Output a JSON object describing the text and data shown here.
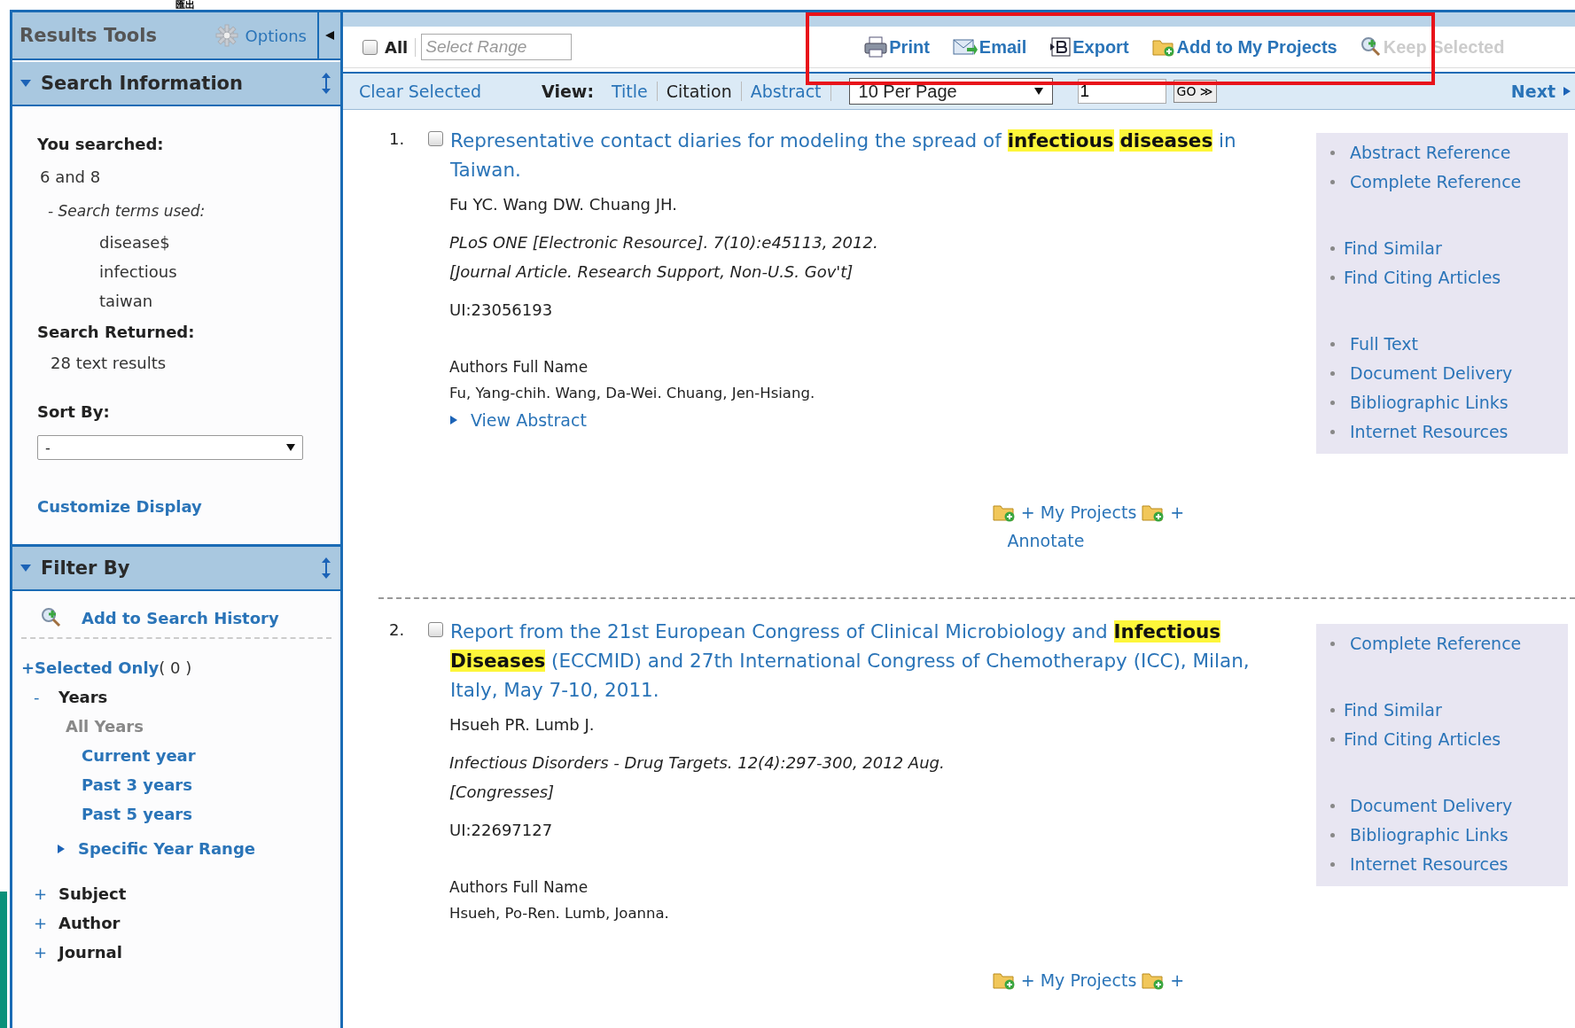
{
  "annotation_text": "匯出",
  "results_tools": {
    "title": "Results Tools",
    "options": "Options"
  },
  "search_information": {
    "title": "Search Information",
    "expanded": true,
    "you_searched_label": "You searched:",
    "query": "6 and 8",
    "terms_label": "- Search terms used:",
    "terms": [
      "disease$",
      "infectious",
      "taiwan"
    ],
    "returned_label": "Search Returned:",
    "returned": "28 text results",
    "sort_label": "Sort By:",
    "sort_value": "-",
    "customize": "Customize Display"
  },
  "filter_by": {
    "title": "Filter By",
    "expanded": true,
    "add_history": "Add to Search History",
    "selected_only": "+Selected Only",
    "selected_count": "( 0 )",
    "groups": [
      {
        "toggle": "-",
        "label": "Years",
        "expanded": true,
        "children": [
          {
            "label": "All Years",
            "selected": true
          },
          {
            "label": "Current year",
            "selected": false
          },
          {
            "label": "Past 3 years",
            "selected": false
          },
          {
            "label": "Past 5 years",
            "selected": false
          }
        ],
        "range": "Specific Year Range"
      },
      {
        "toggle": "+",
        "label": "Subject",
        "expanded": false
      },
      {
        "toggle": "+",
        "label": "Author",
        "expanded": false
      },
      {
        "toggle": "+",
        "label": "Journal",
        "expanded": false
      }
    ]
  },
  "toolbar": {
    "all_label": "All",
    "all_checked": false,
    "range_placeholder": "Select Range",
    "actions": [
      {
        "kind": "print",
        "label": "Print",
        "disabled": false
      },
      {
        "kind": "email",
        "label": "Email",
        "disabled": false
      },
      {
        "kind": "export",
        "label": "Export",
        "disabled": false
      },
      {
        "kind": "projects",
        "label": "Add to My Projects",
        "disabled": false
      },
      {
        "kind": "keep",
        "label": "Keep Selected",
        "disabled": true
      }
    ],
    "clear": "Clear Selected",
    "view_label": "View:",
    "views": [
      {
        "label": "Title",
        "selected": false
      },
      {
        "label": "Citation",
        "selected": true
      },
      {
        "label": "Abstract",
        "selected": false
      }
    ],
    "per_page": "10 Per Page",
    "page": "1",
    "go": "GO ≫",
    "next": "Next"
  },
  "results": [
    {
      "number": "1.",
      "checked": false,
      "title": "Representative contact diaries for modeling the spread of **infectious** **diseases** in Taiwan.",
      "authors": "Fu YC. Wang DW. Chuang JH.",
      "source": "PLoS ONE [Electronic Resource]. 7(10):e45113, 2012.",
      "pub_type": "[Journal Article. Research Support, Non-U.S. Gov't]",
      "ui_label": "UI:",
      "ui": "23056193",
      "full_name_label": "Authors Full Name",
      "full_names": "Fu, Yang-chih. Wang, Da-Wei. Chuang, Jen-Hsiang.",
      "view_abstract": "View Abstract",
      "link_groups": [
        [
          "Abstract Reference",
          "Complete Reference"
        ],
        [
          "Find Similar",
          "Find Citing Articles"
        ],
        [
          "Full Text",
          "Document Delivery",
          "Bibliographic Links",
          "Internet Resources"
        ]
      ],
      "my_projects": "+ My Projects",
      "annotate_plus": "+",
      "annotate": "Annotate"
    },
    {
      "number": "2.",
      "checked": false,
      "title": "Report from the 21st European Congress of Clinical Microbiology and **Infectious** **Diseases** (ECCMID) and 27th International Congress of Chemotherapy (ICC), Milan, Italy, May 7-10, 2011.",
      "authors": "Hsueh PR. Lumb J.",
      "source": "Infectious Disorders - Drug Targets. 12(4):297-300, 2012 Aug.",
      "pub_type": "[Congresses]",
      "ui_label": "UI:",
      "ui": "22697127",
      "full_name_label": "Authors Full Name",
      "full_names": "Hsueh, Po-Ren. Lumb, Joanna.",
      "link_groups": [
        [
          "Complete Reference"
        ],
        [
          "Find Similar",
          "Find Citing Articles"
        ],
        [
          "Document Delivery",
          "Bibliographic Links",
          "Internet Resources"
        ]
      ],
      "my_projects": "+ My Projects",
      "annotate_plus": "+"
    }
  ]
}
